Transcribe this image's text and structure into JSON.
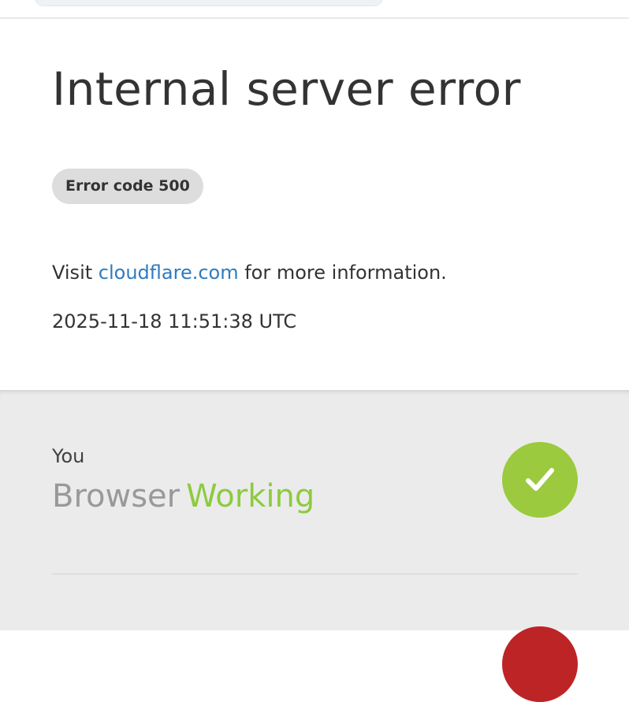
{
  "error": {
    "title": "Internal server error",
    "code_badge": "Error code 500",
    "info_prefix": "Visit",
    "info_link": "cloudflare.com",
    "info_suffix": "for more information.",
    "timestamp": "2025-11-18 11:51:38 UTC"
  },
  "status": {
    "you": {
      "label": "You",
      "component": "Browser",
      "state": "Working",
      "icon": "check-icon",
      "state_color": "#9bca3e"
    },
    "next": {
      "icon": "error-icon",
      "state_color": "#bd2426"
    }
  },
  "colors": {
    "link": "#2f7bbf",
    "working": "#8ccb3f",
    "badge_bg": "#dddddd",
    "status_bg": "#ebebeb"
  }
}
